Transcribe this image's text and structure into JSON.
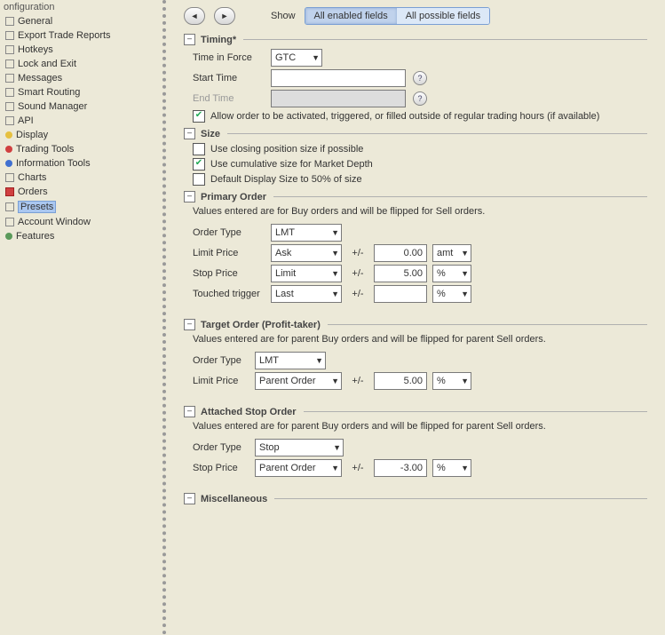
{
  "sidebar": {
    "header": "onfiguration",
    "items": [
      {
        "label": "General",
        "icon": "box"
      },
      {
        "label": "Export Trade Reports",
        "icon": "box"
      },
      {
        "label": "Hotkeys",
        "icon": "box"
      },
      {
        "label": "Lock and Exit",
        "icon": "box"
      },
      {
        "label": "Messages",
        "icon": "box"
      },
      {
        "label": "Smart Routing",
        "icon": "box"
      },
      {
        "label": "Sound Manager",
        "icon": "box"
      },
      {
        "label": "API",
        "icon": "box"
      },
      {
        "label": "Display",
        "icon": "yellow"
      },
      {
        "label": "Trading Tools",
        "icon": "red"
      },
      {
        "label": "Information Tools",
        "icon": "blue"
      },
      {
        "label": "Charts",
        "icon": "box"
      },
      {
        "label": "Orders",
        "icon": "redbox"
      },
      {
        "label": "Presets",
        "icon": "box",
        "selected": true
      },
      {
        "label": "Account Window",
        "icon": "box"
      },
      {
        "label": "Features",
        "icon": "gear"
      }
    ]
  },
  "toolbar": {
    "show_label": "Show",
    "btn_enabled": "All enabled fields",
    "btn_possible": "All possible fields"
  },
  "sections": {
    "timing": {
      "title": "Timing*",
      "time_in_force_label": "Time in Force",
      "time_in_force_value": "GTC",
      "start_time_label": "Start Time",
      "start_time_value": "",
      "end_time_label": "End Time",
      "end_time_value": "",
      "allow_label": "Allow order to be activated, triggered, or filled outside of regular trading hours (if available)"
    },
    "size": {
      "title": "Size",
      "cb_closing": "Use closing position size if possible",
      "cb_cumulative": "Use cumulative size for Market Depth",
      "cb_default": "Default Display Size to 50% of size"
    },
    "primary": {
      "title": "Primary Order",
      "hint": "Values entered are for Buy orders and will be flipped for Sell orders.",
      "order_type_label": "Order Type",
      "order_type_value": "LMT",
      "limit_price_label": "Limit Price",
      "limit_price_base": "Ask",
      "limit_price_pm": "+/-",
      "limit_price_val": "0.00",
      "limit_price_unit": "amt",
      "stop_price_label": "Stop Price",
      "stop_price_base": "Limit",
      "stop_price_pm": "+/-",
      "stop_price_val": "5.00",
      "stop_price_unit": "%",
      "touched_label": "Touched trigger",
      "touched_base": "Last",
      "touched_pm": "+/-",
      "touched_val": "",
      "touched_unit": "%"
    },
    "target": {
      "title": "Target Order (Profit-taker)",
      "hint": "Values entered are for parent Buy orders and will be flipped for parent Sell orders.",
      "order_type_label": "Order Type",
      "order_type_value": "LMT",
      "limit_price_label": "Limit Price",
      "limit_price_base": "Parent Order",
      "limit_price_pm": "+/-",
      "limit_price_val": "5.00",
      "limit_price_unit": "%"
    },
    "attached": {
      "title": "Attached Stop Order",
      "hint": "Values entered are for parent Buy orders and will be flipped for parent Sell orders.",
      "order_type_label": "Order Type",
      "order_type_value": "Stop",
      "stop_price_label": "Stop Price",
      "stop_price_base": "Parent Order",
      "stop_price_pm": "+/-",
      "stop_price_val": "-3.00",
      "stop_price_unit": "%"
    },
    "misc": {
      "title": "Miscellaneous"
    }
  }
}
